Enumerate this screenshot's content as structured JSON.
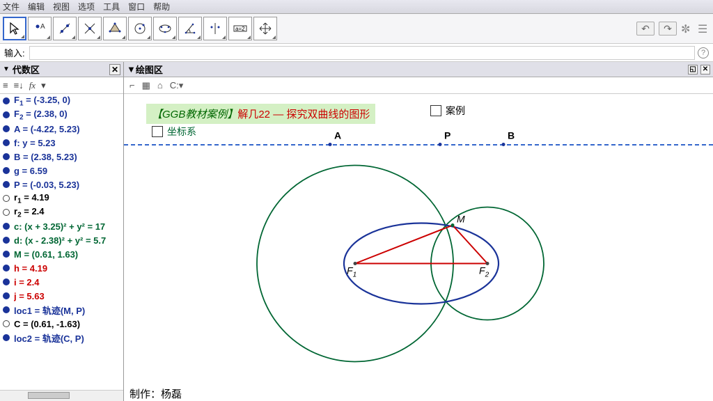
{
  "menu": {
    "file": "文件",
    "edit": "编辑",
    "view": "视图",
    "options": "选项",
    "tools": "工具",
    "window": "窗口",
    "help": "帮助"
  },
  "input_label": "输入:",
  "left": {
    "title": "代数区",
    "fx": "fx",
    "items": [
      {
        "bullet": "filled",
        "color": "c-blue",
        "html": "F<sub>1</sub> = (-3.25, 0)"
      },
      {
        "bullet": "filled",
        "color": "c-blue",
        "html": "F<sub>2</sub> = (2.38, 0)"
      },
      {
        "bullet": "filled",
        "color": "c-blue",
        "html": "A = (-4.22, 5.23)"
      },
      {
        "bullet": "filled",
        "color": "c-blue",
        "html": "f: y = 5.23"
      },
      {
        "bullet": "filled",
        "color": "c-blue",
        "html": "B = (2.38, 5.23)"
      },
      {
        "bullet": "filled",
        "color": "c-blue",
        "html": "g = 6.59"
      },
      {
        "bullet": "filled",
        "color": "c-blue",
        "html": "P = (-0.03, 5.23)"
      },
      {
        "bullet": "hollow",
        "color": "c-black",
        "html": "r<sub>1</sub> = 4.19"
      },
      {
        "bullet": "hollow",
        "color": "c-black",
        "html": "r<sub>2</sub> = 2.4"
      },
      {
        "bullet": "filled",
        "color": "c-green",
        "html": "c: (x + 3.25)² + y² = 17"
      },
      {
        "bullet": "filled",
        "color": "c-green",
        "html": "d: (x - 2.38)² + y² = 5.7"
      },
      {
        "bullet": "filled",
        "color": "c-green",
        "html": "M = (0.61, 1.63)"
      },
      {
        "bullet": "filled",
        "color": "c-red",
        "html": "h = 4.19"
      },
      {
        "bullet": "filled",
        "color": "c-red",
        "html": "i = 2.4"
      },
      {
        "bullet": "filled",
        "color": "c-red",
        "html": "j = 5.63"
      },
      {
        "bullet": "filled",
        "color": "c-blue",
        "html": "loc1 = 轨迹(M, P)"
      },
      {
        "bullet": "hollow",
        "color": "c-black",
        "html": "C = (0.61, -1.63)"
      },
      {
        "bullet": "filled",
        "color": "c-blue",
        "html": "loc2 = 轨迹(C, P)"
      }
    ]
  },
  "right": {
    "title": "绘图区",
    "case_title_1": "【GGB教材案例】",
    "case_title_2": "解几22 — 探究双曲线的图形",
    "cb_case": "案例",
    "cb_coord": "坐标系",
    "labels": {
      "A": "A",
      "P": "P",
      "B": "B",
      "M": "M",
      "F1": "F",
      "F2": "F"
    },
    "footer": "制作：杨磊"
  },
  "chart_data": {
    "type": "geometry",
    "points": {
      "F1": [
        -3.25,
        0
      ],
      "F2": [
        2.38,
        0
      ],
      "A": [
        -4.22,
        5.23
      ],
      "B": [
        2.38,
        5.23
      ],
      "P": [
        -0.03,
        5.23
      ],
      "M": [
        0.61,
        1.63
      ],
      "C": [
        0.61,
        -1.63
      ]
    },
    "values": {
      "g": 6.59,
      "r1": 4.19,
      "r2": 2.4,
      "h": 4.19,
      "i": 2.4,
      "j": 5.63
    },
    "circles": [
      {
        "name": "c",
        "center": "F1",
        "r": 4.19,
        "eq": "(x + 3.25)² + y² = 17"
      },
      {
        "name": "d",
        "center": "F2",
        "r": 2.4,
        "eq": "(x - 2.38)² + y² = 5.7"
      }
    ],
    "line_f": "y = 5.23",
    "loci": [
      "loc1 = 轨迹(M, P)",
      "loc2 = 轨迹(C, P)"
    ]
  }
}
